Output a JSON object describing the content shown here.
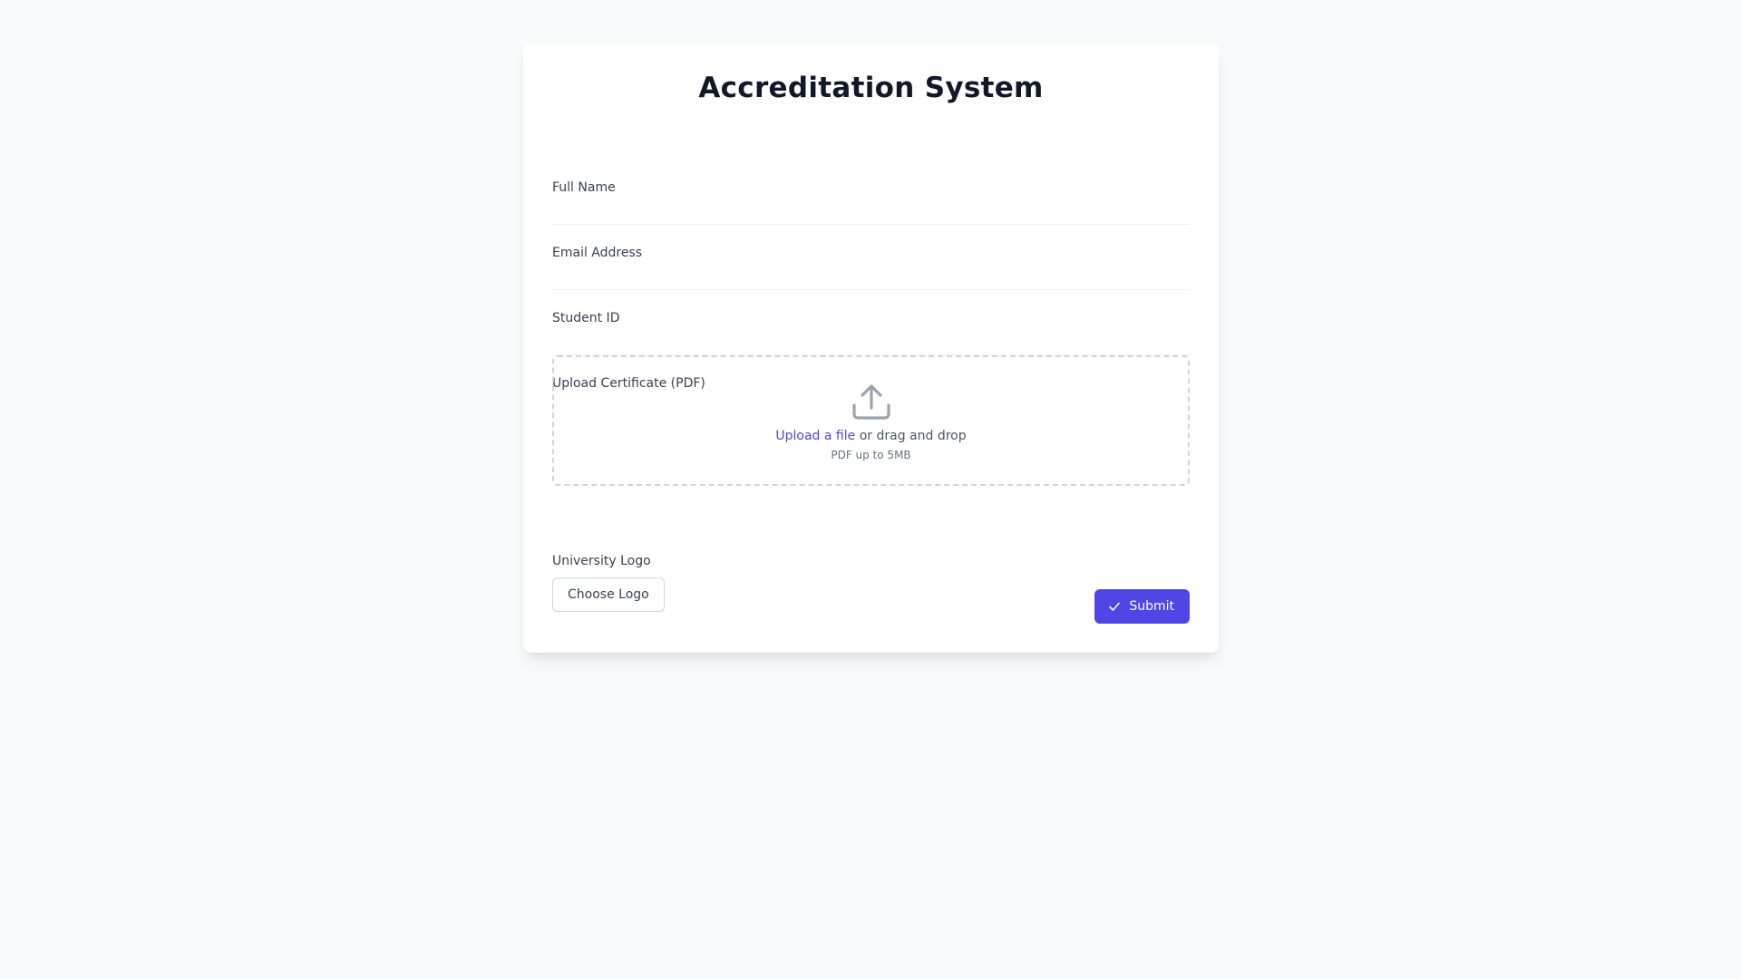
{
  "app": {
    "title": "Accreditation System"
  },
  "form": {
    "full_name": {
      "label": "Full Name",
      "value": "",
      "placeholder": ""
    },
    "email": {
      "label": "Email Address",
      "value": "",
      "placeholder": ""
    },
    "student_id": {
      "label": "Student ID",
      "value": "",
      "placeholder": ""
    },
    "certificate": {
      "label": "Upload Certificate (PDF)",
      "link_text": "Upload a file",
      "suffix_text": " or drag and drop",
      "hint": "PDF up to 5MB",
      "icon": "upload-icon"
    },
    "logo": {
      "label": "University Logo",
      "button_label": "Choose Logo"
    },
    "submit": {
      "label": "Submit",
      "icon": "check-icon"
    }
  },
  "colors": {
    "page_background": "#f9fafb",
    "card_background": "#ffffff",
    "accent": "#4f46e5",
    "title_text": "#111827",
    "label_text": "#374151",
    "muted_text": "#6b7280",
    "border": "#d1d5db"
  }
}
